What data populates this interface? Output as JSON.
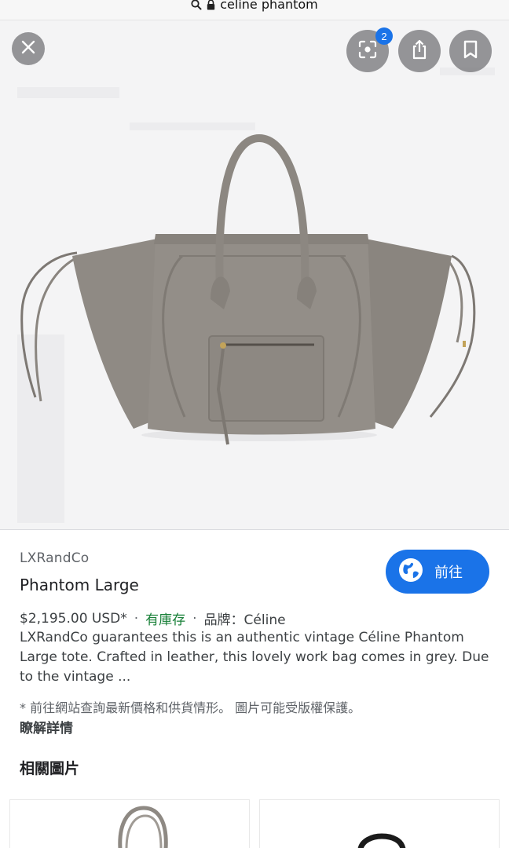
{
  "urlbar": {
    "url_text": "celine phantom",
    "search_icon": "search-icon",
    "lock_icon": "lock-icon"
  },
  "viewer": {
    "close_icon": "close-icon",
    "lens_icon": "lens-icon",
    "lens_badge_count": "2",
    "share_icon": "share-icon",
    "bookmark_icon": "bookmark-icon"
  },
  "result": {
    "source": "LXRandCo",
    "title": "Phantom Large",
    "visit_label": "前往",
    "visit_icon": "globe-icon",
    "price": "$2,195.00 USD*",
    "separator": "·",
    "stock": "有庫存",
    "brand": "品牌：Céline",
    "description": "LXRandCo guarantees this is an authentic vintage Céline Phantom Large tote. Crafted in leather, this lovely work bag comes in grey. Due to the vintage ...",
    "note": "* 前往網站查詢最新價格和供貨情形。 圖片可能受版權保護。",
    "learn_more": "瞭解詳情"
  },
  "related": {
    "heading": "相關圖片"
  },
  "colors": {
    "accent": "#1a73e8",
    "stock": "#188038",
    "bag": "#8f8a84"
  }
}
